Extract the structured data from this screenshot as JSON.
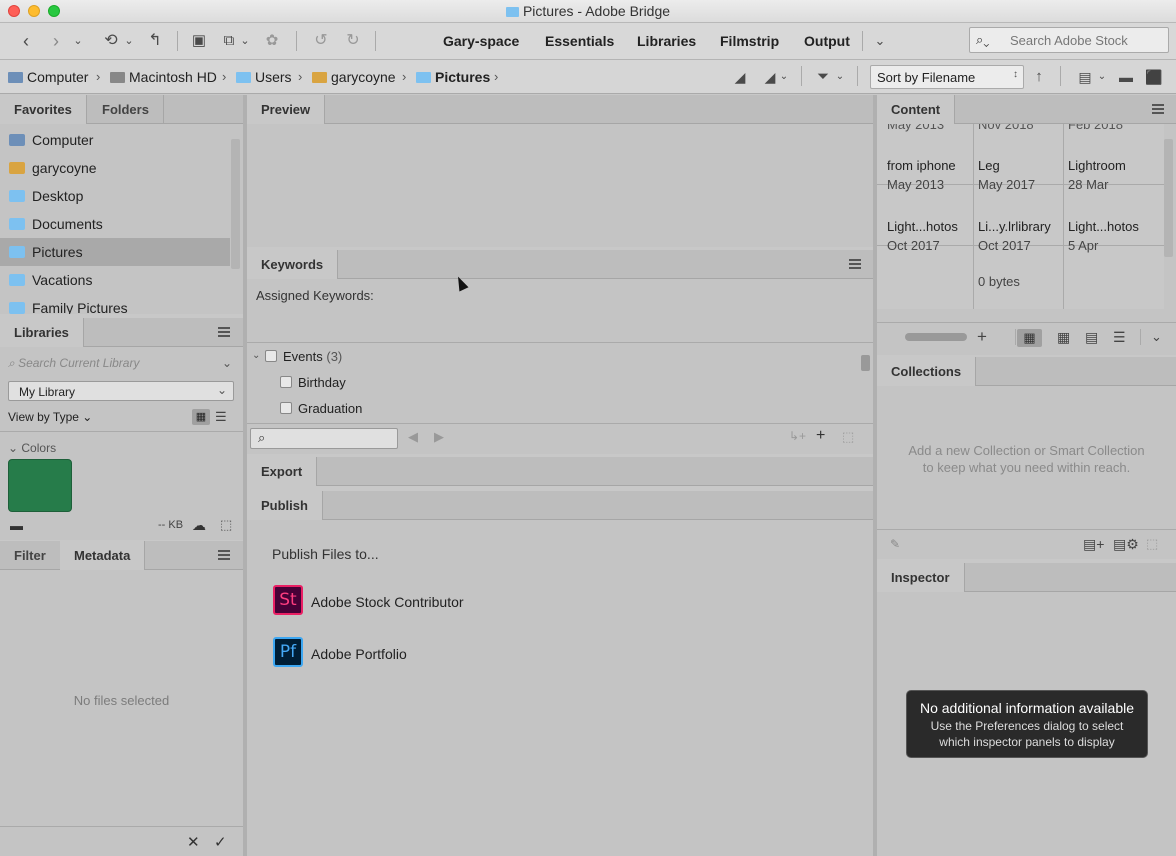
{
  "window": {
    "title": "Pictures - Adobe Bridge"
  },
  "toolbar": {
    "workspaces": [
      "Gary-space",
      "Essentials",
      "Libraries",
      "Filmstrip",
      "Output"
    ],
    "search_placeholder": "Search Adobe Stock"
  },
  "breadcrumb": [
    {
      "label": "Computer",
      "icon": "computer-icon"
    },
    {
      "label": "Macintosh HD",
      "icon": "disk-icon"
    },
    {
      "label": "Users",
      "icon": "folder-icon"
    },
    {
      "label": "garycoyne",
      "icon": "home-icon"
    },
    {
      "label": "Pictures",
      "icon": "folder-icon"
    }
  ],
  "sort": {
    "label": "Sort by Filename"
  },
  "favorites": {
    "tabs": [
      "Favorites",
      "Folders"
    ],
    "items": [
      {
        "label": "Computer",
        "icon": "computer-icon"
      },
      {
        "label": "garycoyne",
        "icon": "home-icon"
      },
      {
        "label": "Desktop",
        "icon": "folder-icon"
      },
      {
        "label": "Documents",
        "icon": "folder-icon"
      },
      {
        "label": "Pictures",
        "icon": "folder-icon"
      },
      {
        "label": "Vacations",
        "icon": "folder-icon"
      },
      {
        "label": "Family Pictures",
        "icon": "folder-icon"
      }
    ]
  },
  "libraries": {
    "tab": "Libraries",
    "search_placeholder": "Search Current Library",
    "library": "My Library",
    "view_by": "View by Type",
    "section": "Colors",
    "color": "#267c4a",
    "size": "-- KB"
  },
  "filter": {
    "tabs": [
      "Filter",
      "Metadata"
    ],
    "empty": "No files selected"
  },
  "preview": {
    "tab": "Preview"
  },
  "keywords": {
    "tab": "Keywords",
    "assigned_label": "Assigned Keywords:",
    "group": "Events",
    "group_count": "(3)",
    "items": [
      "Birthday",
      "Graduation"
    ]
  },
  "export": {
    "tab": "Export"
  },
  "publish": {
    "tab": "Publish",
    "heading": "Publish Files to...",
    "services": [
      {
        "label": "Adobe Stock Contributor",
        "abbr": "St"
      },
      {
        "label": "Adobe Portfolio",
        "abbr": "Pf"
      }
    ]
  },
  "content": {
    "tab": "Content",
    "row0": [
      "May 2013",
      "Nov 2018",
      "Feb 2018"
    ],
    "cells": [
      {
        "name": "from iphone",
        "date": "May 2013"
      },
      {
        "name": "Leg",
        "date": "May 2017"
      },
      {
        "name": "Lightroom",
        "date": "28 Mar"
      },
      {
        "name": "Light...hotos",
        "date": "Oct 2017"
      },
      {
        "name": "Li...y.lrlibrary",
        "date": "Oct 2017"
      },
      {
        "name": "Light...hotos",
        "date": "5 Apr"
      }
    ],
    "extra": "0 bytes"
  },
  "collections": {
    "tab": "Collections",
    "hint_line1": "Add a new Collection or Smart Collection",
    "hint_line2": "to keep what you need within reach."
  },
  "inspector": {
    "tab": "Inspector",
    "tooltip_title": "No additional information available",
    "tooltip_line1": "Use the Preferences dialog to select",
    "tooltip_line2": "which inspector panels to display"
  }
}
